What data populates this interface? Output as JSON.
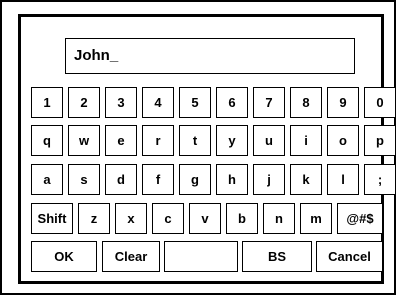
{
  "input": {
    "value": "John_"
  },
  "keyboard": {
    "row1": [
      "1",
      "2",
      "3",
      "4",
      "5",
      "6",
      "7",
      "8",
      "9",
      "0"
    ],
    "row2": [
      "q",
      "w",
      "e",
      "r",
      "t",
      "y",
      "u",
      "i",
      "o",
      "p"
    ],
    "row3": [
      "a",
      "s",
      "d",
      "f",
      "g",
      "h",
      "j",
      "k",
      "l",
      ";"
    ],
    "row4": [
      "Shift",
      "z",
      "x",
      "c",
      "v",
      "b",
      "n",
      "m",
      "@#$"
    ],
    "row5": {
      "ok": "OK",
      "clear": "Clear",
      "space": "",
      "backspace": "BS",
      "cancel": "Cancel"
    }
  }
}
